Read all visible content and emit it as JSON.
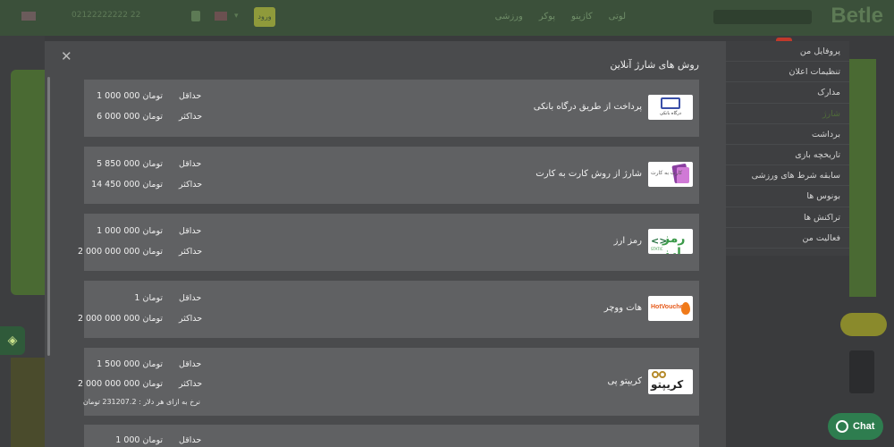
{
  "background": {
    "logo": "Betle",
    "nav": [
      "لوتی",
      "کازینو",
      "پوکر",
      "ورزشی"
    ],
    "phone": "02122222222 22",
    "topbtn": "ورود"
  },
  "side_menu": {
    "items": [
      {
        "label": "پروفایل من",
        "active": false
      },
      {
        "label": "تنظیمات اعلان",
        "active": false
      },
      {
        "label": "مدارک",
        "active": false
      },
      {
        "label": "شارژ",
        "active": true
      },
      {
        "label": "برداشت",
        "active": false
      },
      {
        "label": "تاریخچه بازی",
        "active": false
      },
      {
        "label": "سابقه شرط های ورزشی",
        "active": false
      },
      {
        "label": "بونوس ها",
        "active": false
      },
      {
        "label": "تراکنش ها",
        "active": false
      },
      {
        "label": "فعالیت من",
        "active": false
      }
    ]
  },
  "modal": {
    "title": "روش های شارژ آنلاین",
    "close_icon": "close-icon",
    "min_label": "حداقل",
    "max_label": "حداکثر",
    "methods": [
      {
        "name": "پرداخت از طریق درگاه بانکی",
        "logo": "bank-gateway-logo",
        "logo_text": "درگاه بانکی",
        "min": "1 000 000 تومان",
        "max": "6 000 000 تومان"
      },
      {
        "name": "شارژ از روش کارت به کارت",
        "logo": "card-to-card-logo",
        "logo_text": "کارت به کارت",
        "min": "5 850 000 تومان",
        "max": "14 450 000 تومان"
      },
      {
        "name": "رمز ارز",
        "logo": "crypto-logo",
        "logo_text": "رمز ارز",
        "logo_sub": "STATIC",
        "min": "1 000 000 تومان",
        "max": "2 000 000 000 تومان"
      },
      {
        "name": "هات ووچر",
        "logo": "hot-voucher-logo",
        "logo_text": "HotVoucher",
        "min": "1 تومان",
        "max": "2 000 000 000 تومان"
      },
      {
        "name": "کریپتو پی",
        "logo": "crypto-pay-logo",
        "logo_text": "کریپتو پی",
        "min": "1 500 000 تومان",
        "max": "2 000 000 000 تومان",
        "rate": "نرخ به ازای هر دلار : 231207.2 تومان"
      },
      {
        "name": "",
        "logo": "",
        "min": "1 000 تومان",
        "max": ""
      }
    ]
  },
  "chat": {
    "label": "Chat",
    "icon": "chat-icon"
  },
  "colors": {
    "accent_green": "#2e7d4f",
    "modal_bg": "#4a4b4d",
    "row_bg": "#606163"
  }
}
